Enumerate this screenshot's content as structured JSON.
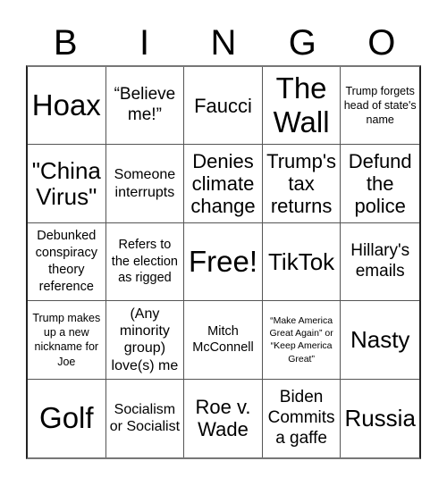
{
  "header": {
    "letters": [
      "B",
      "I",
      "N",
      "G",
      "O"
    ]
  },
  "cells": [
    [
      "Hoax",
      "“Believe me!”",
      "Faucci",
      "The Wall",
      "Trump forgets head of state's name"
    ],
    [
      "\"China Virus\"",
      "Someone interrupts",
      "Denies climate change",
      "Trump's tax returns",
      "Defund the police"
    ],
    [
      "Debunked conspiracy theory reference",
      "Refers to the election as rigged",
      "Free!",
      "TikTok",
      "Hillary's emails"
    ],
    [
      "Trump makes up a new nickname for Joe",
      "(Any minority group) love(s) me",
      "Mitch McConnell",
      "“Make America Great Again” or “Keep America Great”",
      "Nasty"
    ],
    [
      "Golf",
      "Socialism or Socialist",
      "Roe v. Wade",
      "Biden Commits a gaffe",
      "Russia"
    ]
  ]
}
